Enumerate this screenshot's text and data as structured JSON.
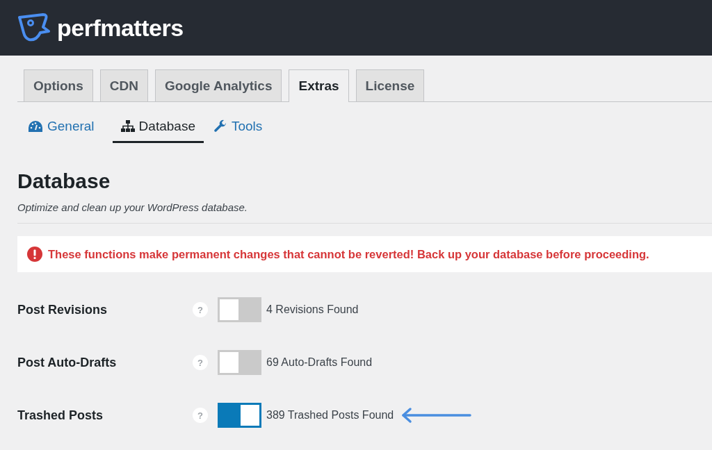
{
  "header": {
    "brand": "perfmatters"
  },
  "tabs": [
    {
      "label": "Options",
      "selected": false
    },
    {
      "label": "CDN",
      "selected": false
    },
    {
      "label": "Google Analytics",
      "selected": false
    },
    {
      "label": "Extras",
      "selected": true
    },
    {
      "label": "License",
      "selected": false
    }
  ],
  "subtabs": [
    {
      "label": "General",
      "kind": "gauge",
      "selected": false
    },
    {
      "label": "Database",
      "kind": "sitemap",
      "selected": true
    },
    {
      "label": "Tools",
      "kind": "wrench",
      "selected": false
    }
  ],
  "section": {
    "title": "Database",
    "description": "Optimize and clean up your WordPress database."
  },
  "notice": {
    "text": "These functions make permanent changes that cannot be reverted! Back up your database before proceeding."
  },
  "rows": [
    {
      "label": "Post Revisions",
      "help": "?",
      "on": false,
      "status": "4 Revisions Found",
      "pointed": false
    },
    {
      "label": "Post Auto-Drafts",
      "help": "?",
      "on": false,
      "status": "69 Auto-Drafts Found",
      "pointed": false
    },
    {
      "label": "Trashed Posts",
      "help": "?",
      "on": true,
      "status": "389 Trashed Posts Found",
      "pointed": true
    }
  ]
}
